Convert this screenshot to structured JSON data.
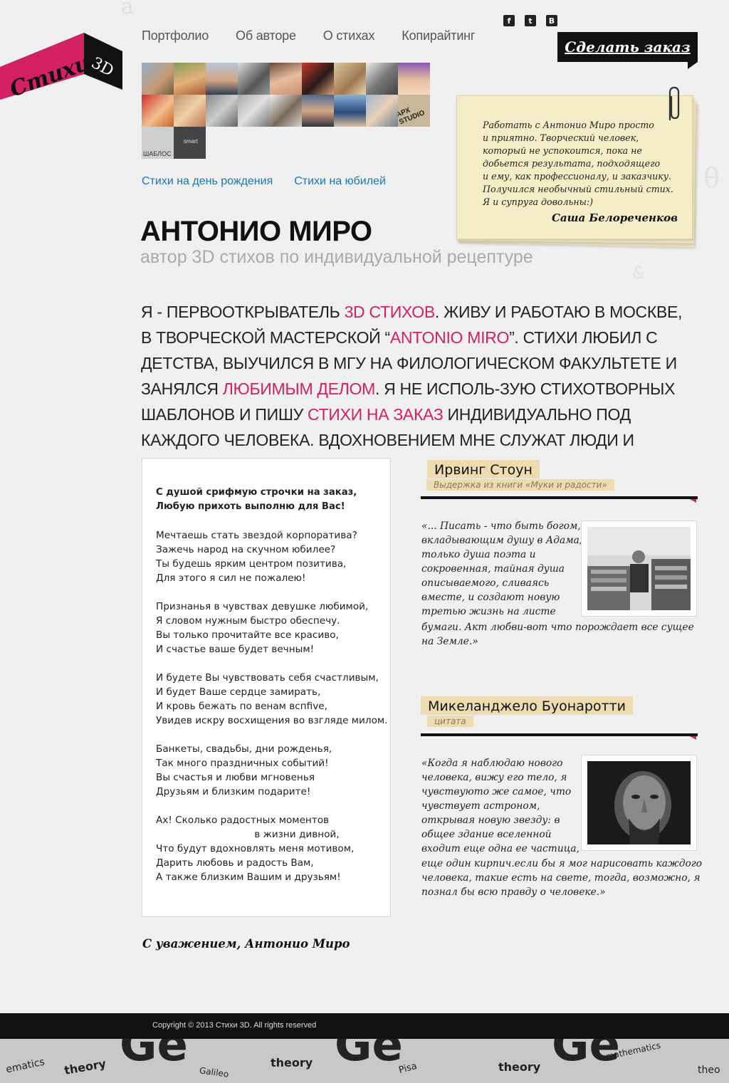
{
  "logo": {
    "word": "Стихи",
    "suffix": "3D"
  },
  "nav": [
    "Портфолио",
    "Об авторе",
    "О стихах",
    "Копирайтинг"
  ],
  "social": [
    {
      "icon": "facebook-icon",
      "glyph": "f"
    },
    {
      "icon": "twitter-icon",
      "glyph": "t"
    },
    {
      "icon": "vkontakte-icon",
      "glyph": "B"
    }
  ],
  "order_button": "Сделать заказ",
  "grid_tiles_text": {
    "studio": "АРХ STUDIO",
    "shablon": "ШАБЛОС",
    "smart": "smart"
  },
  "sub_links": [
    "Стихи на день рождения",
    "Стихи на юбилей"
  ],
  "testimonial": {
    "text": "Работать с Антонио Миро просто\nи приятно. Творческий человек,\nкоторый не успокоится, пока не\nдобьется результата, подходящего\nи ему, как профессионалу, и заказчику.\nПолучился необычный стильный стих.\nЯ и супруга довольны:)",
    "author": "Саша Белореченков"
  },
  "heading": {
    "title": "АНТОНИО МИРО",
    "subtitle": "автор 3D стихов по индивидуальной рецептуре"
  },
  "intro": {
    "p1": "Я - первооткрыватель ",
    "l1": "3D стихов",
    "p2": ". Живу и работаю в Москве, в творческой мастерской “",
    "l2": "Antonio Miro",
    "p3": "”. Стихи любил с детства, выучился в МГУ на филологическом факультете и занялся ",
    "l3": "любимым делом",
    "p4": ".  Я не исполь-зую стихотворных шаблонов и пишу ",
    "l4": "стихи на заказ",
    "p5": " индивидуально под каждого человека. Вдохновением мне служат люди и книги."
  },
  "poem": {
    "head": [
      "С душой срифмую строчки на заказ,",
      "Любую прихоть выполню для Вас!"
    ],
    "stanzas": [
      "Мечтаешь стать звездой корпоратива?\nЗажечь народ на скучном юбилее?\nТы будешь ярким центром позитива,\nДля этого я сил не пожалею!",
      "Признанья в чувствах девушке любимой,\nЯ словом нужным быстро обеспечу.\nВы только прочитайте все красиво,\nИ счастье ваше будет вечным!",
      "И будете Вы чувствовать себя счастливым,\nИ будет Ваше сердце замирать,\nИ кровь бежать по венам вспfive,\nУвидев искру восхищения во взгляде милом.",
      "Банкеты, свадьбы, дни рожденья,\nТак много праздничных событий!\nВы счастья и любви мгновенья\nДрузьям и близким подарите!",
      "Ах! Сколько радостных моментов\n                                в жизни дивной,\nЧто будут вдохновлять меня мотивом,\nДарить любовь и радость Вам,\nА также близким Вашим и друзьям!"
    ]
  },
  "signature": "С уважением, Антонио Миро",
  "quotes": [
    {
      "name": "Ирвинг Стоун",
      "source": "Выдержка из книги «Муки и радости»",
      "text_top": "«... Писать - что быть богом,\nвкладывающим душу в Адама;\nтолько душа поэта и\nсокровенная, тайная душа\nописываемого, сливаясь\nвместе, и создают новую\nтретью жизнь на листе",
      "text_bottom": "бумаги. Акт любви-вот что порождает все сущее\nна Земле.»"
    },
    {
      "name": "Микеланджело Буонаротти",
      "source": "цитата",
      "text_top": "«Когда я наблюдаю нового\nчеловека, вижу его тело, я\nчувствуюто же самое, что\nчувствует астроном,\nоткрывая новую звезду: в\nобщее здание вселенной\nвходит еще одна ее частица,",
      "text_bottom": "еще один кирпич.если бы я мог нарисовать каждого\nчеловека, такие есть на свете, тогда, возможно, я\nпознал бы всю правду о человеке.»"
    }
  ],
  "footer": {
    "copyright": "Copyright © 2013 Стихи 3D. All rights reserved"
  },
  "colors": {
    "accent": "#d32163",
    "link": "#1d75ad",
    "note": "#f5ecc8",
    "label": "#ecdcb0"
  }
}
